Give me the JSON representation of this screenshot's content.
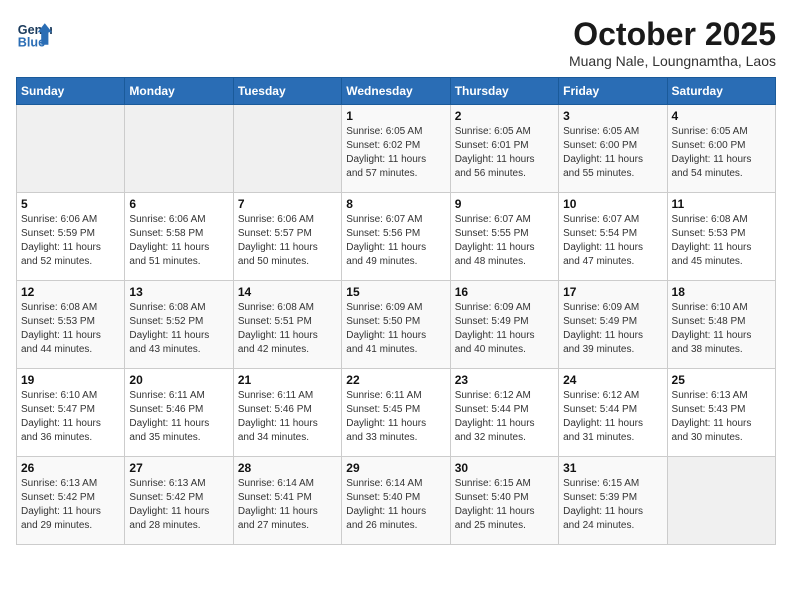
{
  "header": {
    "logo_line1": "General",
    "logo_line2": "Blue",
    "title": "October 2025",
    "subtitle": "Muang Nale, Loungnamtha, Laos"
  },
  "weekdays": [
    "Sunday",
    "Monday",
    "Tuesday",
    "Wednesday",
    "Thursday",
    "Friday",
    "Saturday"
  ],
  "weeks": [
    [
      {
        "day": "",
        "info": ""
      },
      {
        "day": "",
        "info": ""
      },
      {
        "day": "",
        "info": ""
      },
      {
        "day": "1",
        "info": "Sunrise: 6:05 AM\nSunset: 6:02 PM\nDaylight: 11 hours\nand 57 minutes."
      },
      {
        "day": "2",
        "info": "Sunrise: 6:05 AM\nSunset: 6:01 PM\nDaylight: 11 hours\nand 56 minutes."
      },
      {
        "day": "3",
        "info": "Sunrise: 6:05 AM\nSunset: 6:00 PM\nDaylight: 11 hours\nand 55 minutes."
      },
      {
        "day": "4",
        "info": "Sunrise: 6:05 AM\nSunset: 6:00 PM\nDaylight: 11 hours\nand 54 minutes."
      }
    ],
    [
      {
        "day": "5",
        "info": "Sunrise: 6:06 AM\nSunset: 5:59 PM\nDaylight: 11 hours\nand 52 minutes."
      },
      {
        "day": "6",
        "info": "Sunrise: 6:06 AM\nSunset: 5:58 PM\nDaylight: 11 hours\nand 51 minutes."
      },
      {
        "day": "7",
        "info": "Sunrise: 6:06 AM\nSunset: 5:57 PM\nDaylight: 11 hours\nand 50 minutes."
      },
      {
        "day": "8",
        "info": "Sunrise: 6:07 AM\nSunset: 5:56 PM\nDaylight: 11 hours\nand 49 minutes."
      },
      {
        "day": "9",
        "info": "Sunrise: 6:07 AM\nSunset: 5:55 PM\nDaylight: 11 hours\nand 48 minutes."
      },
      {
        "day": "10",
        "info": "Sunrise: 6:07 AM\nSunset: 5:54 PM\nDaylight: 11 hours\nand 47 minutes."
      },
      {
        "day": "11",
        "info": "Sunrise: 6:08 AM\nSunset: 5:53 PM\nDaylight: 11 hours\nand 45 minutes."
      }
    ],
    [
      {
        "day": "12",
        "info": "Sunrise: 6:08 AM\nSunset: 5:53 PM\nDaylight: 11 hours\nand 44 minutes."
      },
      {
        "day": "13",
        "info": "Sunrise: 6:08 AM\nSunset: 5:52 PM\nDaylight: 11 hours\nand 43 minutes."
      },
      {
        "day": "14",
        "info": "Sunrise: 6:08 AM\nSunset: 5:51 PM\nDaylight: 11 hours\nand 42 minutes."
      },
      {
        "day": "15",
        "info": "Sunrise: 6:09 AM\nSunset: 5:50 PM\nDaylight: 11 hours\nand 41 minutes."
      },
      {
        "day": "16",
        "info": "Sunrise: 6:09 AM\nSunset: 5:49 PM\nDaylight: 11 hours\nand 40 minutes."
      },
      {
        "day": "17",
        "info": "Sunrise: 6:09 AM\nSunset: 5:49 PM\nDaylight: 11 hours\nand 39 minutes."
      },
      {
        "day": "18",
        "info": "Sunrise: 6:10 AM\nSunset: 5:48 PM\nDaylight: 11 hours\nand 38 minutes."
      }
    ],
    [
      {
        "day": "19",
        "info": "Sunrise: 6:10 AM\nSunset: 5:47 PM\nDaylight: 11 hours\nand 36 minutes."
      },
      {
        "day": "20",
        "info": "Sunrise: 6:11 AM\nSunset: 5:46 PM\nDaylight: 11 hours\nand 35 minutes."
      },
      {
        "day": "21",
        "info": "Sunrise: 6:11 AM\nSunset: 5:46 PM\nDaylight: 11 hours\nand 34 minutes."
      },
      {
        "day": "22",
        "info": "Sunrise: 6:11 AM\nSunset: 5:45 PM\nDaylight: 11 hours\nand 33 minutes."
      },
      {
        "day": "23",
        "info": "Sunrise: 6:12 AM\nSunset: 5:44 PM\nDaylight: 11 hours\nand 32 minutes."
      },
      {
        "day": "24",
        "info": "Sunrise: 6:12 AM\nSunset: 5:44 PM\nDaylight: 11 hours\nand 31 minutes."
      },
      {
        "day": "25",
        "info": "Sunrise: 6:13 AM\nSunset: 5:43 PM\nDaylight: 11 hours\nand 30 minutes."
      }
    ],
    [
      {
        "day": "26",
        "info": "Sunrise: 6:13 AM\nSunset: 5:42 PM\nDaylight: 11 hours\nand 29 minutes."
      },
      {
        "day": "27",
        "info": "Sunrise: 6:13 AM\nSunset: 5:42 PM\nDaylight: 11 hours\nand 28 minutes."
      },
      {
        "day": "28",
        "info": "Sunrise: 6:14 AM\nSunset: 5:41 PM\nDaylight: 11 hours\nand 27 minutes."
      },
      {
        "day": "29",
        "info": "Sunrise: 6:14 AM\nSunset: 5:40 PM\nDaylight: 11 hours\nand 26 minutes."
      },
      {
        "day": "30",
        "info": "Sunrise: 6:15 AM\nSunset: 5:40 PM\nDaylight: 11 hours\nand 25 minutes."
      },
      {
        "day": "31",
        "info": "Sunrise: 6:15 AM\nSunset: 5:39 PM\nDaylight: 11 hours\nand 24 minutes."
      },
      {
        "day": "",
        "info": ""
      }
    ]
  ]
}
